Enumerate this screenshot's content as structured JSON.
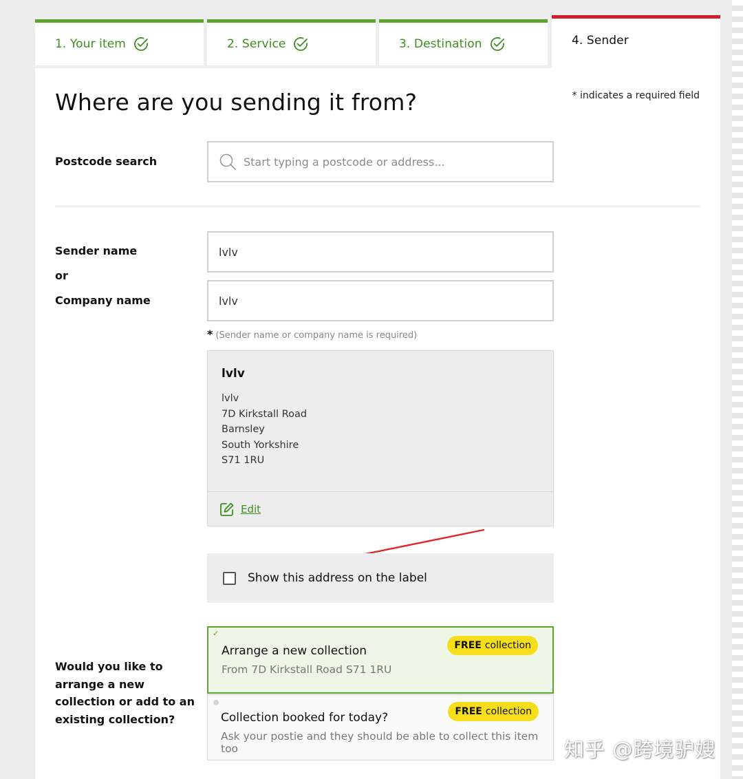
{
  "tabs": [
    {
      "label": "1. Your item",
      "state": "complete"
    },
    {
      "label": "2. Service",
      "state": "complete"
    },
    {
      "label": "3. Destination",
      "state": "complete"
    },
    {
      "label": "4. Sender",
      "state": "active"
    }
  ],
  "page": {
    "title": "Where are you sending it from?",
    "required_note": "* indicates a required field"
  },
  "postcode": {
    "label": "Postcode search",
    "placeholder": "Start typing a postcode or address..."
  },
  "sender": {
    "name_label": "Sender name",
    "or_label": "or",
    "company_label": "Company name",
    "name_value": "lvlv",
    "company_value": "lvlv",
    "hint_star": "*",
    "hint": "(Sender name or company name is required)"
  },
  "address_card": {
    "name": "lvlv",
    "lines": [
      "lvlv",
      "7D Kirkstall Road",
      "Barnsley",
      "South Yorkshire",
      "S71 1RU"
    ],
    "edit_label": "Edit"
  },
  "show_address": {
    "label": "Show this address on the label",
    "checked": false
  },
  "collection": {
    "question": "Would you like to arrange a new collection or add to an existing collection?",
    "options": [
      {
        "title": "Arrange a new collection",
        "subtitle": "From 7D Kirkstall Road S71 1RU",
        "badge_bold": "FREE",
        "badge_text": "collection",
        "selected": true
      },
      {
        "title": "Collection booked for today?",
        "subtitle": "Ask your postie and they should be able to collect this item too",
        "badge_bold": "FREE",
        "badge_text": "collection",
        "selected": false
      }
    ]
  },
  "watermark": "知乎 @跨境驴嫂",
  "colors": {
    "accent_green": "#5ca52c",
    "active_red": "#d01e2e",
    "badge_yellow": "#f6df1a",
    "annotation_red": "#e0262a"
  },
  "icons": [
    "check-circle-icon",
    "search-icon",
    "edit-icon",
    "checkbox-icon",
    "check-mark-icon"
  ]
}
